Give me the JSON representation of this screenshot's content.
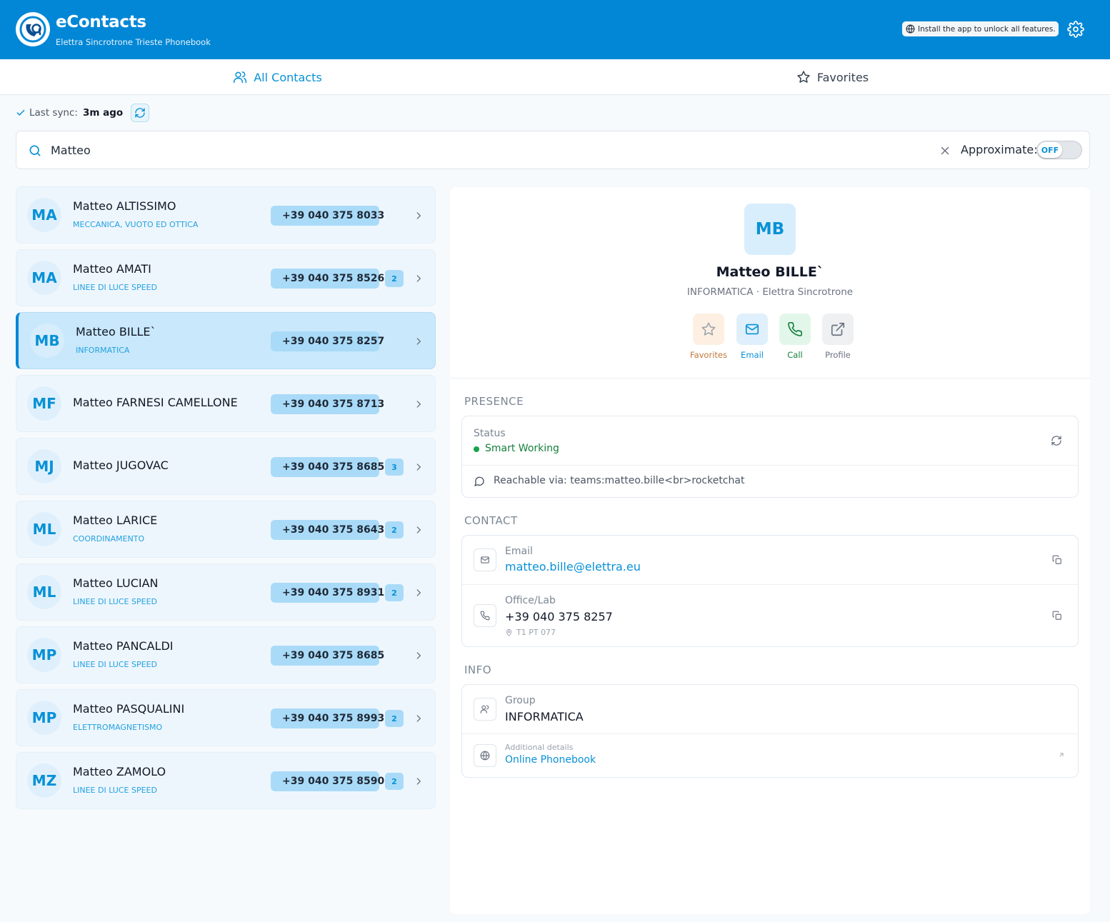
{
  "header": {
    "title": "eContacts",
    "subtitle": "Elettra Sincrotrone Trieste Phonebook",
    "install_notice": "Install the app to unlock all features.",
    "brand_color": "#0287d6"
  },
  "tabs": [
    {
      "label": "All Contacts",
      "icon": "users-icon",
      "active": true
    },
    {
      "label": "Favorites",
      "icon": "star-icon",
      "active": false
    }
  ],
  "sync": {
    "label": "Last sync:",
    "value": "3m ago"
  },
  "search": {
    "value": "Matteo",
    "approximate_label": "Approximate:",
    "approximate_state": "OFF"
  },
  "contacts": [
    {
      "initials": "MA",
      "name": "Matteo ALTISSIMO",
      "dept": "MECCANICA, VUOTO ED OTTICA",
      "phone": "+39 040 375 8033",
      "count": ""
    },
    {
      "initials": "MA",
      "name": "Matteo AMATI",
      "dept": "LINEE DI LUCE SPEED",
      "phone": "+39 040 375 8526",
      "count": "2"
    },
    {
      "initials": "MB",
      "name": "Matteo BILLE`",
      "dept": "INFORMATICA",
      "phone": "+39 040 375 8257",
      "count": "",
      "selected": true
    },
    {
      "initials": "MF",
      "name": "Matteo FARNESI CAMELLONE",
      "dept": "",
      "phone": "+39 040 375 8713",
      "count": ""
    },
    {
      "initials": "MJ",
      "name": "Matteo JUGOVAC",
      "dept": "",
      "phone": "+39 040 375 8685",
      "count": "3"
    },
    {
      "initials": "ML",
      "name": "Matteo LARICE",
      "dept": "COORDINAMENTO",
      "phone": "+39 040 375 8643",
      "count": "2"
    },
    {
      "initials": "ML",
      "name": "Matteo LUCIAN",
      "dept": "LINEE DI LUCE SPEED",
      "phone": "+39 040 375 8931",
      "count": "2"
    },
    {
      "initials": "MP",
      "name": "Matteo PANCALDI",
      "dept": "LINEE DI LUCE SPEED",
      "phone": "+39 040 375 8685",
      "count": ""
    },
    {
      "initials": "MP",
      "name": "Matteo PASQUALINI",
      "dept": "ELETTROMAGNETISMO",
      "phone": "+39 040 375 8993",
      "count": "2"
    },
    {
      "initials": "MZ",
      "name": "Matteo ZAMOLO",
      "dept": "LINEE DI LUCE SPEED",
      "phone": "+39 040 375 8590",
      "count": "2"
    }
  ],
  "detail": {
    "initials": "MB",
    "name": "Matteo BILLE`",
    "subtitle": "INFORMATICA · Elettra Sincrotrone",
    "actions": [
      {
        "label": "Favorites",
        "icon": "star-icon",
        "color": "#c2783a"
      },
      {
        "label": "Email",
        "icon": "mail-icon",
        "color": "#0891d6"
      },
      {
        "label": "Call",
        "icon": "phone-icon",
        "color": "#15803d"
      },
      {
        "label": "Profile",
        "icon": "external-link-icon",
        "color": "#6b7280"
      }
    ],
    "presence": {
      "section_title": "PRESENCE",
      "status_label": "Status",
      "status_value": "Smart Working",
      "status_color": "#16a34a",
      "reachable": "Reachable via: teams:matteo.bille<br>rocketchat"
    },
    "contact": {
      "section_title": "CONTACT",
      "email_label": "Email",
      "email_value": "matteo.bille@elettra.eu",
      "office_label": "Office/Lab",
      "office_value": "+39 040 375 8257",
      "office_location": "T1 PT 077"
    },
    "info": {
      "section_title": "INFO",
      "group_label": "Group",
      "group_value": "INFORMATICA",
      "additional_label": "Additional details",
      "additional_value": "Online Phonebook"
    }
  }
}
